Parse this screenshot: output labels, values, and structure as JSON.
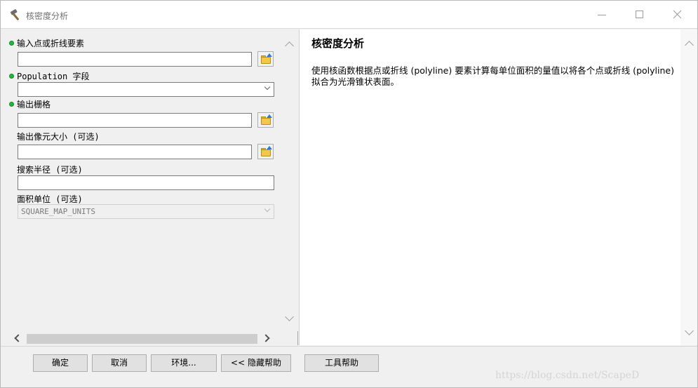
{
  "window": {
    "title": "核密度分析",
    "controls": {
      "minimize": "—",
      "maximize": "☐",
      "close": "✕"
    }
  },
  "params": {
    "input_features": {
      "label": "输入点或折线要素",
      "value": "",
      "required": true
    },
    "population_field": {
      "label": "Population 字段",
      "value": "",
      "required": true
    },
    "output_raster": {
      "label": "输出栅格",
      "value": "",
      "required": true
    },
    "cell_size": {
      "label": "输出像元大小 (可选)",
      "value": ""
    },
    "search_radius": {
      "label": "搜索半径 (可选)",
      "value": ""
    },
    "area_units": {
      "label": "面积单位 (可选)",
      "value": "SQUARE_MAP_UNITS"
    }
  },
  "help": {
    "title": "核密度分析",
    "body": "使用核函数根据点或折线 (polyline) 要素计算每单位面积的量值以将各个点或折线 (polyline) 拟合为光滑锥状表面。"
  },
  "buttons": {
    "ok": "确定",
    "cancel": "取消",
    "environments": "环境...",
    "hide_help": "<< 隐藏帮助",
    "tool_help": "工具帮助"
  },
  "watermark": "https://blog.csdn.net/ScapeD",
  "icons": {
    "app": "hammer-icon",
    "browse": "open-folder-icon"
  },
  "colors": {
    "required_dot": "#1dbb3a",
    "folder": "#f1c84b"
  }
}
